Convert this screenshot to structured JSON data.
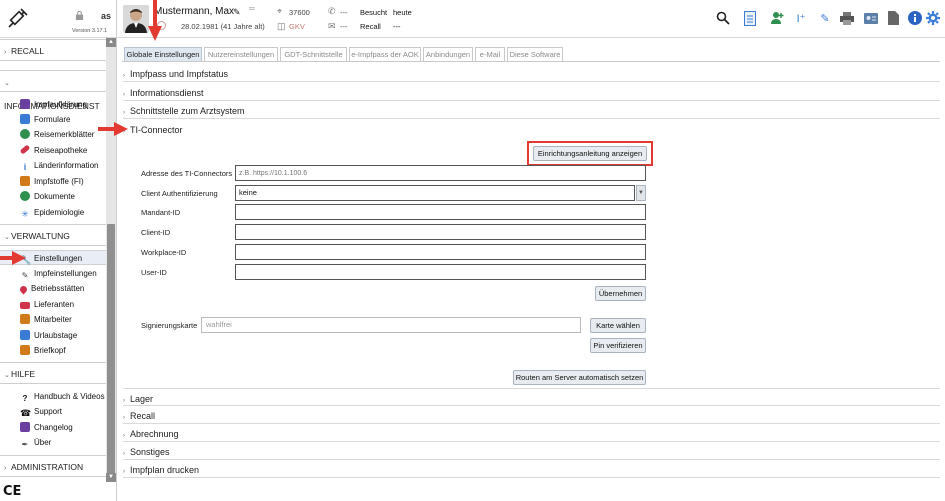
{
  "sidebar": {
    "user_initials": "as",
    "version": "Version 3.17.1",
    "sections": [
      {
        "label": "RECALL",
        "chevron": "›"
      },
      {
        "label": "INFORMATIONSDIENST",
        "chevron": "⌄"
      },
      {
        "label": "VERWALTUNG",
        "chevron": "⌄"
      },
      {
        "label": "HILFE",
        "chevron": "⌄"
      },
      {
        "label": "ADMINISTRATION",
        "chevron": "›"
      }
    ],
    "info_items": [
      {
        "label": "Impfaufklärung",
        "icon": "document-icon",
        "color": "#6b3fa0"
      },
      {
        "label": "Formulare",
        "icon": "form-icon",
        "color": "#3a7bd5"
      },
      {
        "label": "Reisemerkblätter",
        "icon": "globe-icon",
        "color": "#2f8f4e"
      },
      {
        "label": "Reiseapotheke",
        "icon": "pill-icon",
        "color": "#d0344a"
      },
      {
        "label": "Länderinformation",
        "icon": "info-icon",
        "color": "#3a7bd5"
      },
      {
        "label": "Impfstoffe (FI)",
        "icon": "vaccine-icon",
        "color": "#d07a1a"
      },
      {
        "label": "Dokumente",
        "icon": "globe-doc-icon",
        "color": "#2f8f4e"
      },
      {
        "label": "Epidemiologie",
        "icon": "virus-icon",
        "color": "#3a7bd5"
      }
    ],
    "admin_items": [
      {
        "label": "Einstellungen",
        "icon": "wrench-icon",
        "color": "#444444"
      },
      {
        "label": "Impfeinstellungen",
        "icon": "syringe-icon",
        "color": "#444444"
      },
      {
        "label": "Betriebsstätten",
        "icon": "pin-icon",
        "color": "#d0344a"
      },
      {
        "label": "Lieferanten",
        "icon": "truck-icon",
        "color": "#d0344a"
      },
      {
        "label": "Mitarbeiter",
        "icon": "people-icon",
        "color": "#d07a1a"
      },
      {
        "label": "Urlaubstage",
        "icon": "calendar-icon",
        "color": "#3a7bd5"
      },
      {
        "label": "Briefkopf",
        "icon": "letter-icon",
        "color": "#d07a1a"
      }
    ],
    "help_items": [
      {
        "label": "Handbuch & Videos",
        "icon": "question-icon",
        "color": "#111111"
      },
      {
        "label": "Support",
        "icon": "phone-icon",
        "color": "#111111"
      },
      {
        "label": "Changelog",
        "icon": "changelog-icon",
        "color": "#6b3fa0"
      },
      {
        "label": "Über",
        "icon": "pen-icon",
        "color": "#444444"
      }
    ],
    "ce_mark": "CE"
  },
  "header": {
    "patient_name": "Mustermann, Max",
    "patient_dob": "28.02.1981  (41 Jahre alt)",
    "postal_code": "37600",
    "insurance": "GKV",
    "phone": "---",
    "email": "---",
    "visited_label": "Besucht",
    "visited_value": "heute",
    "recall_label": "Recall",
    "recall_value": "---"
  },
  "tabs": [
    "Globale Einstellungen",
    "Nutzereinstellungen",
    "GDT-Schnittstelle",
    "e-Impfpass der AOK",
    "Anbindungen",
    "e-Mail",
    "Diese Software"
  ],
  "accordion": {
    "impfpass": "Impfpass und Impfstatus",
    "informationsdienst": "Informationsdienst",
    "schnittstelle": "Schnittstelle zum Arztsystem",
    "ti_connector": "TI-Connector",
    "lager": "Lager",
    "recall": "Recall",
    "abrechnung": "Abrechnung",
    "sonstiges": "Sonstiges",
    "impfplan": "Impfplan drucken"
  },
  "ti_form": {
    "guide_button": "Einrichtungsanleitung anzeigen",
    "address_label": "Adresse des TI-Connectors",
    "address_placeholder": "z.B. https://10.1.100.6",
    "auth_label": "Client Authentifizierung",
    "auth_value": "keine",
    "mandant_label": "Mandant-ID",
    "client_label": "Client-ID",
    "workplace_label": "Workplace-ID",
    "user_label": "User-ID",
    "apply_button": "Übernehmen",
    "sig_label": "Signierungskarte",
    "sig_value": "wahlfrei",
    "card_button": "Karte wählen",
    "pin_button": "Pin verifizieren",
    "routes_button": "Routen am Server automatisch setzen"
  },
  "colors": {
    "highlight": "#e23a31",
    "active_tab": "#dfe7f1",
    "active_nav": "#e9eef6",
    "brand_blue": "#3a7bd5"
  }
}
